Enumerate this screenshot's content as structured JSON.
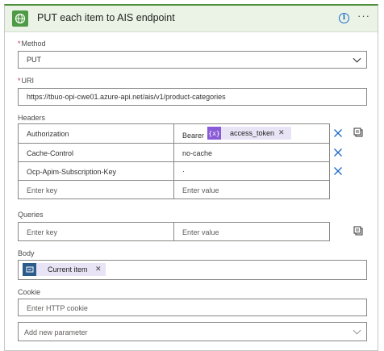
{
  "action": {
    "title": "PUT each item to AIS endpoint"
  },
  "method": {
    "label": "Method",
    "value": "PUT"
  },
  "uri": {
    "label": "URI",
    "value": "https://tbuo-opi-cwe01.azure-api.net/ais/v1/product-categories"
  },
  "headers": {
    "label": "Headers",
    "rows": [
      {
        "key": "Authorization",
        "value_prefix": "Bearer",
        "token": "access_token"
      },
      {
        "key": "Cache-Control",
        "value": "no-cache"
      },
      {
        "key": "Ocp-Apim-Subscription-Key",
        "value": "·"
      }
    ],
    "key_placeholder": "Enter key",
    "value_placeholder": "Enter value"
  },
  "queries": {
    "label": "Queries",
    "key_placeholder": "Enter key",
    "value_placeholder": "Enter value"
  },
  "body": {
    "label": "Body",
    "token": "Current item"
  },
  "cookie": {
    "label": "Cookie",
    "placeholder": "Enter HTTP cookie"
  },
  "add_param": {
    "placeholder": "Add new parameter"
  },
  "colors": {
    "header_bg": "#eaf3e6",
    "accent_green": "#4f9a44",
    "token_purple": "#8a5bd6",
    "token_blue": "#2b5a8c",
    "link_blue": "#1f6bc7"
  }
}
